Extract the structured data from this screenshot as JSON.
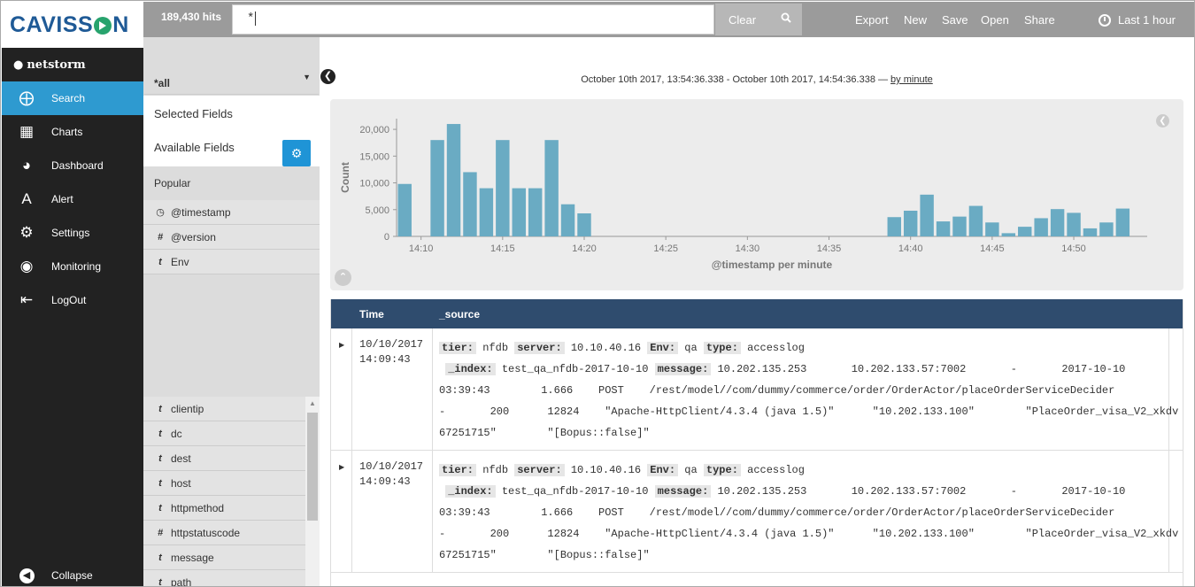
{
  "app": {
    "logo_left": "CAVISS",
    "logo_right": "N",
    "username": "netstorm"
  },
  "nav": {
    "items": [
      {
        "label": "Search",
        "icon": "compass-icon",
        "active": true
      },
      {
        "label": "Charts",
        "icon": "bar-chart-icon"
      },
      {
        "label": "Dashboard",
        "icon": "dashboard-icon"
      },
      {
        "label": "Alert",
        "icon": "alert-icon"
      },
      {
        "label": "Settings",
        "icon": "gear-icon"
      },
      {
        "label": "Monitoring",
        "icon": "globe-icon"
      },
      {
        "label": "LogOut",
        "icon": "logout-icon"
      }
    ],
    "collapse_label": "Collapse"
  },
  "topbar": {
    "hits": "189,430 hits",
    "query": "*",
    "clear_label": "Clear",
    "export_label": "Export",
    "new_label": "New",
    "save_label": "Save",
    "open_label": "Open",
    "share_label": "Share",
    "time_range_label": "Last 1 hour"
  },
  "sidebar": {
    "index_pattern": "*all",
    "selected_fields_title": "Selected Fields",
    "available_fields_title": "Available Fields",
    "popular_title": "Popular",
    "popular_fields": [
      {
        "type": "clock",
        "name": "@timestamp"
      },
      {
        "type": "#",
        "name": "@version"
      },
      {
        "type": "t",
        "name": "Env"
      }
    ],
    "fields": [
      {
        "type": "t",
        "name": "clientip"
      },
      {
        "type": "t",
        "name": "dc"
      },
      {
        "type": "t",
        "name": "dest"
      },
      {
        "type": "t",
        "name": "host"
      },
      {
        "type": "t",
        "name": "httpmethod"
      },
      {
        "type": "#",
        "name": "httpstatuscode"
      },
      {
        "type": "t",
        "name": "message"
      },
      {
        "type": "t",
        "name": "path"
      }
    ]
  },
  "main": {
    "date_range": "October 10th 2017, 13:54:36.338 - October 10th 2017, 14:54:36.338 — ",
    "interval_link": "by minute"
  },
  "chart_data": {
    "type": "bar",
    "xlabel": "@timestamp per minute",
    "ylabel": "Count",
    "yticks": [
      "0",
      "5,000",
      "10,000",
      "15,000",
      "20,000"
    ],
    "ylim": [
      0,
      22000
    ],
    "xticks": [
      "14:10",
      "14:15",
      "14:20",
      "14:25",
      "14:30",
      "14:35",
      "14:40",
      "14:45",
      "14:50"
    ],
    "x": [
      "14:09",
      "14:10",
      "14:11",
      "14:12",
      "14:13",
      "14:14",
      "14:15",
      "14:16",
      "14:17",
      "14:18",
      "14:19",
      "14:20",
      "14:21",
      "14:22",
      "14:23",
      "14:24",
      "14:25",
      "14:26",
      "14:27",
      "14:28",
      "14:29",
      "14:30",
      "14:31",
      "14:32",
      "14:33",
      "14:34",
      "14:35",
      "14:36",
      "14:37",
      "14:38",
      "14:39",
      "14:40",
      "14:41",
      "14:42",
      "14:43",
      "14:44",
      "14:45",
      "14:46",
      "14:47",
      "14:48",
      "14:49",
      "14:50",
      "14:51",
      "14:52",
      "14:53",
      "14:54"
    ],
    "values": [
      9800,
      0,
      18000,
      21000,
      12000,
      9000,
      18000,
      9000,
      9000,
      18000,
      6000,
      4300,
      0,
      0,
      0,
      0,
      0,
      0,
      0,
      0,
      0,
      0,
      0,
      0,
      0,
      0,
      0,
      0,
      0,
      0,
      3600,
      4800,
      7800,
      2800,
      3700,
      5700,
      2600,
      600,
      1800,
      3400,
      5100,
      4400,
      1500,
      2600,
      5200
    ],
    "color": "#6aabc3"
  },
  "table": {
    "col_time": "Time",
    "col_source": "_source",
    "rows": [
      {
        "date": "10/10/2017",
        "time": "14:09:43",
        "tier": "nfdb",
        "server": "10.10.40.16",
        "env": "qa",
        "type": "accesslog",
        "index": "test_qa_nfdb-2017-10-10",
        "message_1": "10.202.135.253       10.202.133.57:7002       -       2017-10-10",
        "message_2": "03:39:43        1.666    POST    /rest/model//com/dummy/commerce/order/OrderActor/placeOrderServiceDecider",
        "message_3": "-       200      12824    \"Apache-HttpClient/4.3.4 (java 1.5)\"      \"10.202.133.100\"        \"PlaceOrder_visa_V2_xkdv",
        "message_4": "67251715\"        \"[Bopus::false]\""
      },
      {
        "date": "10/10/2017",
        "time": "14:09:43",
        "tier": "nfdb",
        "server": "10.10.40.16",
        "env": "qa",
        "type": "accesslog",
        "index": "test_qa_nfdb-2017-10-10",
        "message_1": "10.202.135.253       10.202.133.57:7002       -       2017-10-10",
        "message_2": "03:39:43        1.666    POST    /rest/model//com/dummy/commerce/order/OrderActor/placeOrderServiceDecider",
        "message_3": "-       200      12824    \"Apache-HttpClient/4.3.4 (java 1.5)\"      \"10.202.133.100\"        \"PlaceOrder_visa_V2_xkdv",
        "message_4": "67251715\"        \"[Bopus::false]\""
      }
    ],
    "key_tier": "tier:",
    "key_server": "server:",
    "key_env": "Env:",
    "key_type": "type:",
    "key_index": "_index:",
    "key_message": "message:"
  }
}
